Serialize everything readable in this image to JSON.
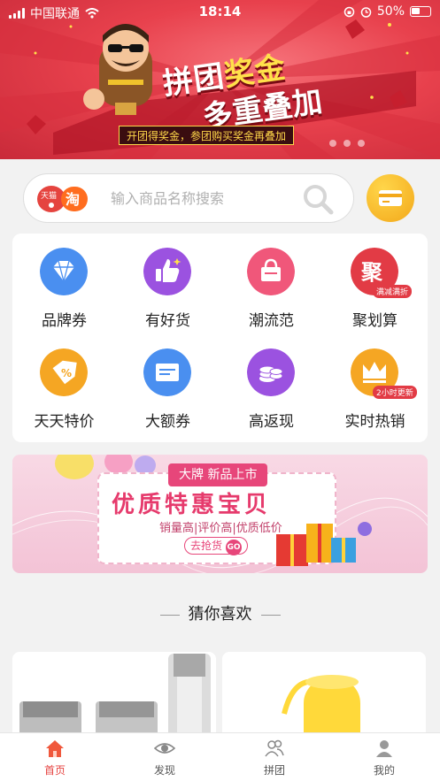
{
  "status_bar": {
    "carrier": "中国联通",
    "time": "18:14",
    "battery": "50%"
  },
  "banner": {
    "title_part1": "拼团",
    "title_highlight": "奖金",
    "title_line2": "多重叠加",
    "subtitle": "开团得奖金，参团购买奖金再叠加"
  },
  "search": {
    "placeholder": "输入商品名称搜索",
    "platform_badge": "天猫 淘"
  },
  "categories": [
    {
      "label": "品牌券",
      "icon": "diamond-icon",
      "color": "#4a8ff0"
    },
    {
      "label": "有好货",
      "icon": "thumbs-up-icon",
      "color": "#9b52e0"
    },
    {
      "label": "潮流范",
      "icon": "shopping-bag-icon",
      "color": "#f0577a"
    },
    {
      "label": "聚划算",
      "icon": "ju-icon",
      "color": "#e23b45",
      "badge": "满减满折"
    },
    {
      "label": "天天特价",
      "icon": "price-tag-icon",
      "color": "#f5a623"
    },
    {
      "label": "大额券",
      "icon": "coupon-icon",
      "color": "#4a8ff0"
    },
    {
      "label": "高返现",
      "icon": "coins-icon",
      "color": "#9b52e0"
    },
    {
      "label": "实时热销",
      "icon": "crown-icon",
      "color": "#f5a623",
      "badge": "2小时更新"
    }
  ],
  "promo": {
    "tag": "大牌 新品上市",
    "headline": "优质特惠宝贝",
    "subline": "销量高|评价高|优质低价",
    "button": "去抢货",
    "button_badge": "GO"
  },
  "section_title": "猜你喜欢",
  "tabbar": [
    {
      "label": "首页",
      "icon": "home-icon",
      "active": true
    },
    {
      "label": "发现",
      "icon": "eye-icon",
      "active": false
    },
    {
      "label": "拼团",
      "icon": "group-icon",
      "active": false
    },
    {
      "label": "我的",
      "icon": "profile-icon",
      "active": false
    }
  ]
}
